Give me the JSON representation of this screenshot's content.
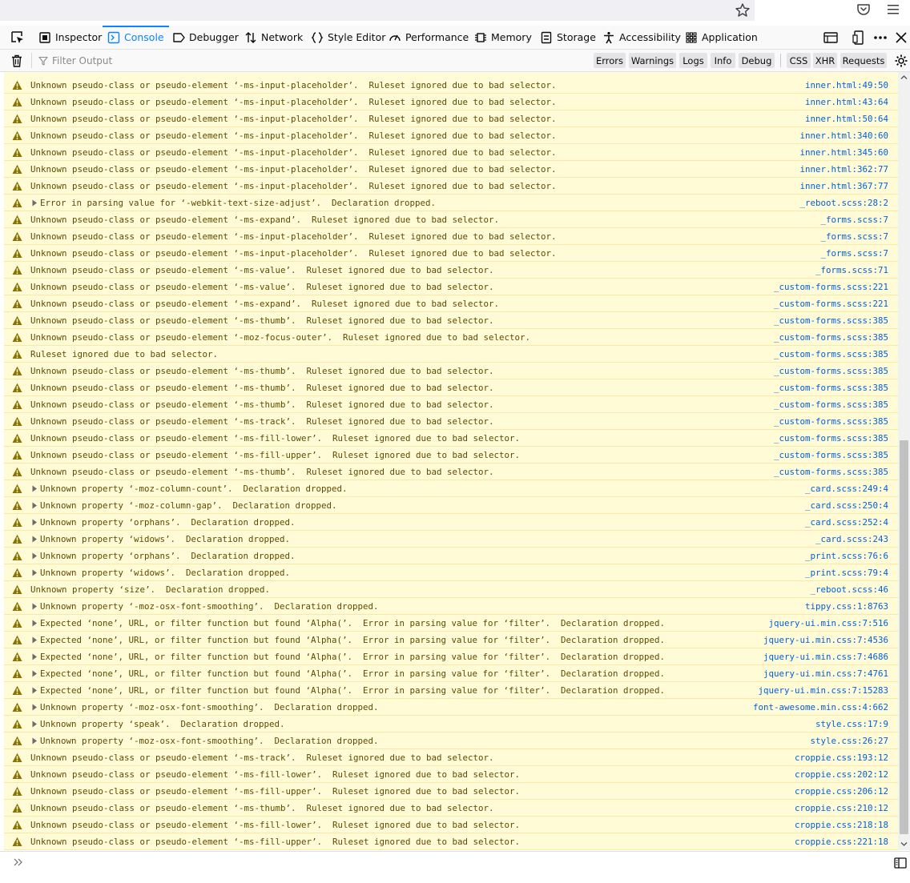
{
  "tabs": [
    {
      "label": "Inspector",
      "icon": "inspector-icon",
      "selected": false
    },
    {
      "label": "Console",
      "icon": "console-icon",
      "selected": true
    },
    {
      "label": "Debugger",
      "icon": "debugger-icon",
      "selected": false
    },
    {
      "label": "Network",
      "icon": "network-icon",
      "selected": false
    },
    {
      "label": "Style Editor",
      "icon": "style-editor-icon",
      "selected": false
    },
    {
      "label": "Performance",
      "icon": "performance-icon",
      "selected": false
    },
    {
      "label": "Memory",
      "icon": "memory-icon",
      "selected": false
    },
    {
      "label": "Storage",
      "icon": "storage-icon",
      "selected": false
    },
    {
      "label": "Accessibility",
      "icon": "accessibility-icon",
      "selected": false
    },
    {
      "label": "Application",
      "icon": "application-icon",
      "selected": false
    }
  ],
  "filter": {
    "placeholder": "Filter Output",
    "levels": [
      "Errors",
      "Warnings",
      "Logs",
      "Info",
      "Debug"
    ],
    "types": [
      "CSS",
      "XHR",
      "Requests"
    ]
  },
  "colors": {
    "accent": "#0a84ff",
    "warning_bg": "#fffbd6",
    "warning_text": "#5f4b00",
    "warning_icon": "#d7b600",
    "source_link": "#0060df"
  },
  "messages": [
    {
      "text": "Unknown pseudo-class or pseudo-element ‘-ms-input-placeholder’.  Ruleset ignored due to bad selector.",
      "source": "inner.html:49:50",
      "expandable": false
    },
    {
      "text": "Unknown pseudo-class or pseudo-element ‘-ms-input-placeholder’.  Ruleset ignored due to bad selector.",
      "source": "inner.html:43:64",
      "expandable": false
    },
    {
      "text": "Unknown pseudo-class or pseudo-element ‘-ms-input-placeholder’.  Ruleset ignored due to bad selector.",
      "source": "inner.html:50:64",
      "expandable": false
    },
    {
      "text": "Unknown pseudo-class or pseudo-element ‘-ms-input-placeholder’.  Ruleset ignored due to bad selector.",
      "source": "inner.html:340:60",
      "expandable": false
    },
    {
      "text": "Unknown pseudo-class or pseudo-element ‘-ms-input-placeholder’.  Ruleset ignored due to bad selector.",
      "source": "inner.html:345:60",
      "expandable": false
    },
    {
      "text": "Unknown pseudo-class or pseudo-element ‘-ms-input-placeholder’.  Ruleset ignored due to bad selector.",
      "source": "inner.html:362:77",
      "expandable": false
    },
    {
      "text": "Unknown pseudo-class or pseudo-element ‘-ms-input-placeholder’.  Ruleset ignored due to bad selector.",
      "source": "inner.html:367:77",
      "expandable": false
    },
    {
      "text": "Error in parsing value for ‘-webkit-text-size-adjust’.  Declaration dropped.",
      "source": "_reboot.scss:28:2",
      "expandable": true
    },
    {
      "text": "Unknown pseudo-class or pseudo-element ‘-ms-expand’.  Ruleset ignored due to bad selector.",
      "source": "_forms.scss:7",
      "expandable": false
    },
    {
      "text": "Unknown pseudo-class or pseudo-element ‘-ms-input-placeholder’.  Ruleset ignored due to bad selector.",
      "source": "_forms.scss:7",
      "expandable": false
    },
    {
      "text": "Unknown pseudo-class or pseudo-element ‘-ms-input-placeholder’.  Ruleset ignored due to bad selector.",
      "source": "_forms.scss:7",
      "expandable": false
    },
    {
      "text": "Unknown pseudo-class or pseudo-element ‘-ms-value’.  Ruleset ignored due to bad selector.",
      "source": "_forms.scss:71",
      "expandable": false
    },
    {
      "text": "Unknown pseudo-class or pseudo-element ‘-ms-value’.  Ruleset ignored due to bad selector.",
      "source": "_custom-forms.scss:221",
      "expandable": false
    },
    {
      "text": "Unknown pseudo-class or pseudo-element ‘-ms-expand’.  Ruleset ignored due to bad selector.",
      "source": "_custom-forms.scss:221",
      "expandable": false
    },
    {
      "text": "Unknown pseudo-class or pseudo-element ‘-ms-thumb’.  Ruleset ignored due to bad selector.",
      "source": "_custom-forms.scss:385",
      "expandable": false
    },
    {
      "text": "Unknown pseudo-class or pseudo-element ‘-moz-focus-outer’.  Ruleset ignored due to bad selector.",
      "source": "_custom-forms.scss:385",
      "expandable": false
    },
    {
      "text": "Ruleset ignored due to bad selector.",
      "source": "_custom-forms.scss:385",
      "expandable": false
    },
    {
      "text": "Unknown pseudo-class or pseudo-element ‘-ms-thumb’.  Ruleset ignored due to bad selector.",
      "source": "_custom-forms.scss:385",
      "expandable": false
    },
    {
      "text": "Unknown pseudo-class or pseudo-element ‘-ms-thumb’.  Ruleset ignored due to bad selector.",
      "source": "_custom-forms.scss:385",
      "expandable": false
    },
    {
      "text": "Unknown pseudo-class or pseudo-element ‘-ms-thumb’.  Ruleset ignored due to bad selector.",
      "source": "_custom-forms.scss:385",
      "expandable": false
    },
    {
      "text": "Unknown pseudo-class or pseudo-element ‘-ms-track’.  Ruleset ignored due to bad selector.",
      "source": "_custom-forms.scss:385",
      "expandable": false
    },
    {
      "text": "Unknown pseudo-class or pseudo-element ‘-ms-fill-lower’.  Ruleset ignored due to bad selector.",
      "source": "_custom-forms.scss:385",
      "expandable": false
    },
    {
      "text": "Unknown pseudo-class or pseudo-element ‘-ms-fill-upper’.  Ruleset ignored due to bad selector.",
      "source": "_custom-forms.scss:385",
      "expandable": false
    },
    {
      "text": "Unknown pseudo-class or pseudo-element ‘-ms-thumb’.  Ruleset ignored due to bad selector.",
      "source": "_custom-forms.scss:385",
      "expandable": false
    },
    {
      "text": "Unknown property ‘-moz-column-count’.  Declaration dropped.",
      "source": "_card.scss:249:4",
      "expandable": true
    },
    {
      "text": "Unknown property ‘-moz-column-gap’.  Declaration dropped.",
      "source": "_card.scss:250:4",
      "expandable": true
    },
    {
      "text": "Unknown property ‘orphans’.  Declaration dropped.",
      "source": "_card.scss:252:4",
      "expandable": true
    },
    {
      "text": "Unknown property ‘widows’.  Declaration dropped.",
      "source": "_card.scss:243",
      "expandable": true
    },
    {
      "text": "Unknown property ‘orphans’.  Declaration dropped.",
      "source": "_print.scss:76:6",
      "expandable": true
    },
    {
      "text": "Unknown property ‘widows’.  Declaration dropped.",
      "source": "_print.scss:79:4",
      "expandable": true
    },
    {
      "text": "Unknown property ‘size’.  Declaration dropped.",
      "source": "_reboot.scss:46",
      "expandable": false
    },
    {
      "text": "Unknown property ‘-moz-osx-font-smoothing’.  Declaration dropped.",
      "source": "tippy.css:1:8763",
      "expandable": true
    },
    {
      "text": "Expected ‘none’, URL, or filter function but found ‘Alpha(’.  Error in parsing value for ‘filter’.  Declaration dropped.",
      "source": "jquery-ui.min.css:7:516",
      "expandable": true
    },
    {
      "text": "Expected ‘none’, URL, or filter function but found ‘Alpha(’.  Error in parsing value for ‘filter’.  Declaration dropped.",
      "source": "jquery-ui.min.css:7:4536",
      "expandable": true
    },
    {
      "text": "Expected ‘none’, URL, or filter function but found ‘Alpha(’.  Error in parsing value for ‘filter’.  Declaration dropped.",
      "source": "jquery-ui.min.css:7:4686",
      "expandable": true
    },
    {
      "text": "Expected ‘none’, URL, or filter function but found ‘Alpha(’.  Error in parsing value for ‘filter’.  Declaration dropped.",
      "source": "jquery-ui.min.css:7:4761",
      "expandable": true
    },
    {
      "text": "Expected ‘none’, URL, or filter function but found ‘Alpha(’.  Error in parsing value for ‘filter’.  Declaration dropped.",
      "source": "jquery-ui.min.css:7:15283",
      "expandable": true
    },
    {
      "text": "Unknown property ‘-moz-osx-font-smoothing’.  Declaration dropped.",
      "source": "font-awesome.min.css:4:662",
      "expandable": true
    },
    {
      "text": "Unknown property ‘speak’.  Declaration dropped.",
      "source": "style.css:17:9",
      "expandable": true
    },
    {
      "text": "Unknown property ‘-moz-osx-font-smoothing’.  Declaration dropped.",
      "source": "style.css:26:27",
      "expandable": true
    },
    {
      "text": "Unknown pseudo-class or pseudo-element ‘-ms-track’.  Ruleset ignored due to bad selector.",
      "source": "croppie.css:193:12",
      "expandable": false
    },
    {
      "text": "Unknown pseudo-class or pseudo-element ‘-ms-fill-lower’.  Ruleset ignored due to bad selector.",
      "source": "croppie.css:202:12",
      "expandable": false
    },
    {
      "text": "Unknown pseudo-class or pseudo-element ‘-ms-fill-upper’.  Ruleset ignored due to bad selector.",
      "source": "croppie.css:206:12",
      "expandable": false
    },
    {
      "text": "Unknown pseudo-class or pseudo-element ‘-ms-thumb’.  Ruleset ignored due to bad selector.",
      "source": "croppie.css:210:12",
      "expandable": false
    },
    {
      "text": "Unknown pseudo-class or pseudo-element ‘-ms-fill-lower’.  Ruleset ignored due to bad selector.",
      "source": "croppie.css:218:18",
      "expandable": false
    },
    {
      "text": "Unknown pseudo-class or pseudo-element ‘-ms-fill-upper’.  Ruleset ignored due to bad selector.",
      "source": "croppie.css:221:18",
      "expandable": false
    }
  ]
}
